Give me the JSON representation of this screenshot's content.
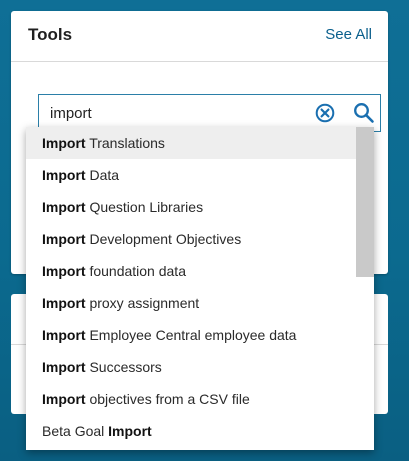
{
  "tools_card": {
    "title": "Tools",
    "see_all_label": "See All"
  },
  "search": {
    "value": "import",
    "clear_icon": "clear-circle-icon",
    "search_icon": "magnifier-icon",
    "accent_color": "#1a6fb0"
  },
  "dropdown": {
    "items": [
      {
        "prefix": "",
        "bold": "Import",
        "rest": " Translations"
      },
      {
        "prefix": "",
        "bold": "Import",
        "rest": " Data"
      },
      {
        "prefix": "",
        "bold": "Import",
        "rest": " Question Libraries"
      },
      {
        "prefix": "",
        "bold": "Import",
        "rest": " Development Objectives"
      },
      {
        "prefix": "",
        "bold": "Import",
        "rest": " foundation data"
      },
      {
        "prefix": "",
        "bold": "Import",
        "rest": " proxy assignment"
      },
      {
        "prefix": "",
        "bold": "Import",
        "rest": " Employee Central employee data"
      },
      {
        "prefix": "",
        "bold": "Import",
        "rest": " Successors"
      },
      {
        "prefix": "",
        "bold": "Import",
        "rest": " objectives from a CSV file"
      },
      {
        "prefix": "Beta Goal ",
        "bold": "Import",
        "rest": ""
      }
    ]
  },
  "colors": {
    "background": "#0d6a90",
    "link": "#0a5f8c",
    "highlight_row": "#eeeeee"
  }
}
